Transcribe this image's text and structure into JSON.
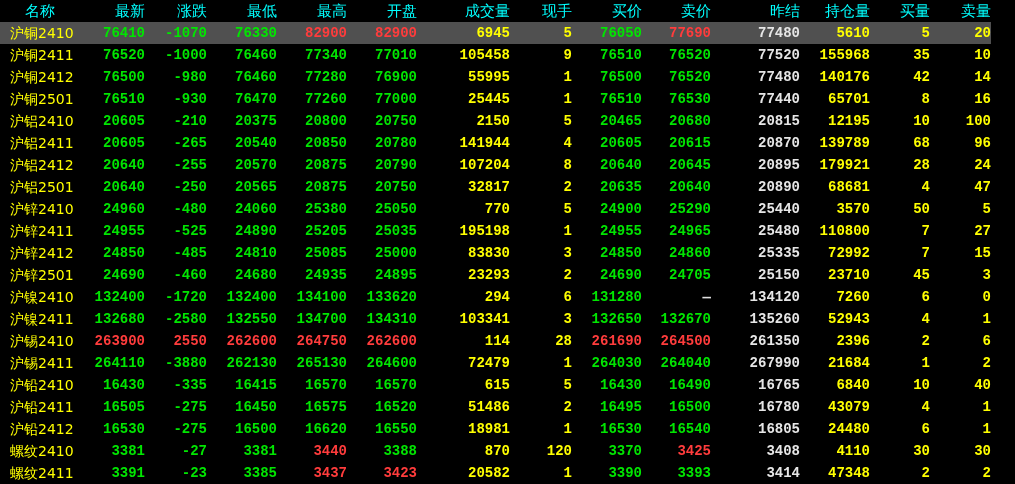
{
  "columns": [
    {
      "label": "名称",
      "kind": "name"
    },
    {
      "label": "最新",
      "kind": "price"
    },
    {
      "label": "涨跌",
      "kind": "price"
    },
    {
      "label": "最低",
      "kind": "price"
    },
    {
      "label": "最高",
      "kind": "price"
    },
    {
      "label": "开盘",
      "kind": "price"
    },
    {
      "label": "成交量",
      "kind": "volume"
    },
    {
      "label": "现手",
      "kind": "volume"
    },
    {
      "label": "买价",
      "kind": "price"
    },
    {
      "label": "卖价",
      "kind": "price"
    },
    {
      "label": "昨结",
      "kind": "settle"
    },
    {
      "label": "持仓量",
      "kind": "volume"
    },
    {
      "label": "买量",
      "kind": "volume"
    },
    {
      "label": "卖量",
      "kind": "volume"
    }
  ],
  "rows": [
    {
      "selected": true,
      "cells": [
        {
          "text": "沪铜2410"
        },
        {
          "text": "76410",
          "color": "#00e600"
        },
        {
          "text": "-1070",
          "color": "#00e600"
        },
        {
          "text": "76330",
          "color": "#00e600"
        },
        {
          "text": "82900",
          "color": "#ff3c3c"
        },
        {
          "text": "82900",
          "color": "#ff3c3c"
        },
        {
          "text": "6945"
        },
        {
          "text": "5"
        },
        {
          "text": "76050",
          "color": "#00e600"
        },
        {
          "text": "77690",
          "color": "#ff3c3c"
        },
        {
          "text": "77480"
        },
        {
          "text": "5610"
        },
        {
          "text": "5"
        },
        {
          "text": "20"
        }
      ]
    },
    {
      "selected": false,
      "cells": [
        {
          "text": "沪铜2411"
        },
        {
          "text": "76520",
          "color": "#00e600"
        },
        {
          "text": "-1000",
          "color": "#00e600"
        },
        {
          "text": "76460",
          "color": "#00e600"
        },
        {
          "text": "77340",
          "color": "#00e600"
        },
        {
          "text": "77010",
          "color": "#00e600"
        },
        {
          "text": "105458"
        },
        {
          "text": "9"
        },
        {
          "text": "76510",
          "color": "#00e600"
        },
        {
          "text": "76520",
          "color": "#00e600"
        },
        {
          "text": "77520"
        },
        {
          "text": "155968"
        },
        {
          "text": "35"
        },
        {
          "text": "10"
        }
      ]
    },
    {
      "selected": false,
      "cells": [
        {
          "text": "沪铜2412"
        },
        {
          "text": "76500",
          "color": "#00e600"
        },
        {
          "text": "-980",
          "color": "#00e600"
        },
        {
          "text": "76460",
          "color": "#00e600"
        },
        {
          "text": "77280",
          "color": "#00e600"
        },
        {
          "text": "76900",
          "color": "#00e600"
        },
        {
          "text": "55995"
        },
        {
          "text": "1"
        },
        {
          "text": "76500",
          "color": "#00e600"
        },
        {
          "text": "76520",
          "color": "#00e600"
        },
        {
          "text": "77480"
        },
        {
          "text": "140176"
        },
        {
          "text": "42"
        },
        {
          "text": "14"
        }
      ]
    },
    {
      "selected": false,
      "cells": [
        {
          "text": "沪铜2501"
        },
        {
          "text": "76510",
          "color": "#00e600"
        },
        {
          "text": "-930",
          "color": "#00e600"
        },
        {
          "text": "76470",
          "color": "#00e600"
        },
        {
          "text": "77260",
          "color": "#00e600"
        },
        {
          "text": "77000",
          "color": "#00e600"
        },
        {
          "text": "25445"
        },
        {
          "text": "1"
        },
        {
          "text": "76510",
          "color": "#00e600"
        },
        {
          "text": "76530",
          "color": "#00e600"
        },
        {
          "text": "77440"
        },
        {
          "text": "65701"
        },
        {
          "text": "8"
        },
        {
          "text": "16"
        }
      ]
    },
    {
      "selected": false,
      "cells": [
        {
          "text": "沪铝2410"
        },
        {
          "text": "20605",
          "color": "#00e600"
        },
        {
          "text": "-210",
          "color": "#00e600"
        },
        {
          "text": "20375",
          "color": "#00e600"
        },
        {
          "text": "20800",
          "color": "#00e600"
        },
        {
          "text": "20750",
          "color": "#00e600"
        },
        {
          "text": "2150"
        },
        {
          "text": "5"
        },
        {
          "text": "20465",
          "color": "#00e600"
        },
        {
          "text": "20680",
          "color": "#00e600"
        },
        {
          "text": "20815"
        },
        {
          "text": "12195"
        },
        {
          "text": "10"
        },
        {
          "text": "100"
        }
      ]
    },
    {
      "selected": false,
      "cells": [
        {
          "text": "沪铝2411"
        },
        {
          "text": "20605",
          "color": "#00e600"
        },
        {
          "text": "-265",
          "color": "#00e600"
        },
        {
          "text": "20540",
          "color": "#00e600"
        },
        {
          "text": "20850",
          "color": "#00e600"
        },
        {
          "text": "20780",
          "color": "#00e600"
        },
        {
          "text": "141944"
        },
        {
          "text": "4"
        },
        {
          "text": "20605",
          "color": "#00e600"
        },
        {
          "text": "20615",
          "color": "#00e600"
        },
        {
          "text": "20870"
        },
        {
          "text": "139789"
        },
        {
          "text": "68"
        },
        {
          "text": "96"
        }
      ]
    },
    {
      "selected": false,
      "cells": [
        {
          "text": "沪铝2412"
        },
        {
          "text": "20640",
          "color": "#00e600"
        },
        {
          "text": "-255",
          "color": "#00e600"
        },
        {
          "text": "20570",
          "color": "#00e600"
        },
        {
          "text": "20875",
          "color": "#00e600"
        },
        {
          "text": "20790",
          "color": "#00e600"
        },
        {
          "text": "107204"
        },
        {
          "text": "8"
        },
        {
          "text": "20640",
          "color": "#00e600"
        },
        {
          "text": "20645",
          "color": "#00e600"
        },
        {
          "text": "20895"
        },
        {
          "text": "179921"
        },
        {
          "text": "28"
        },
        {
          "text": "24"
        }
      ]
    },
    {
      "selected": false,
      "cells": [
        {
          "text": "沪铝2501"
        },
        {
          "text": "20640",
          "color": "#00e600"
        },
        {
          "text": "-250",
          "color": "#00e600"
        },
        {
          "text": "20565",
          "color": "#00e600"
        },
        {
          "text": "20875",
          "color": "#00e600"
        },
        {
          "text": "20750",
          "color": "#00e600"
        },
        {
          "text": "32817"
        },
        {
          "text": "2"
        },
        {
          "text": "20635",
          "color": "#00e600"
        },
        {
          "text": "20640",
          "color": "#00e600"
        },
        {
          "text": "20890"
        },
        {
          "text": "68681"
        },
        {
          "text": "4"
        },
        {
          "text": "47"
        }
      ]
    },
    {
      "selected": false,
      "cells": [
        {
          "text": "沪锌2410"
        },
        {
          "text": "24960",
          "color": "#00e600"
        },
        {
          "text": "-480",
          "color": "#00e600"
        },
        {
          "text": "24060",
          "color": "#00e600"
        },
        {
          "text": "25380",
          "color": "#00e600"
        },
        {
          "text": "25050",
          "color": "#00e600"
        },
        {
          "text": "770"
        },
        {
          "text": "5"
        },
        {
          "text": "24900",
          "color": "#00e600"
        },
        {
          "text": "25290",
          "color": "#00e600"
        },
        {
          "text": "25440"
        },
        {
          "text": "3570"
        },
        {
          "text": "50"
        },
        {
          "text": "5"
        }
      ]
    },
    {
      "selected": false,
      "cells": [
        {
          "text": "沪锌2411"
        },
        {
          "text": "24955",
          "color": "#00e600"
        },
        {
          "text": "-525",
          "color": "#00e600"
        },
        {
          "text": "24890",
          "color": "#00e600"
        },
        {
          "text": "25205",
          "color": "#00e600"
        },
        {
          "text": "25035",
          "color": "#00e600"
        },
        {
          "text": "195198"
        },
        {
          "text": "1"
        },
        {
          "text": "24955",
          "color": "#00e600"
        },
        {
          "text": "24965",
          "color": "#00e600"
        },
        {
          "text": "25480"
        },
        {
          "text": "110800"
        },
        {
          "text": "7"
        },
        {
          "text": "27"
        }
      ]
    },
    {
      "selected": false,
      "cells": [
        {
          "text": "沪锌2412"
        },
        {
          "text": "24850",
          "color": "#00e600"
        },
        {
          "text": "-485",
          "color": "#00e600"
        },
        {
          "text": "24810",
          "color": "#00e600"
        },
        {
          "text": "25085",
          "color": "#00e600"
        },
        {
          "text": "25000",
          "color": "#00e600"
        },
        {
          "text": "83830"
        },
        {
          "text": "3"
        },
        {
          "text": "24850",
          "color": "#00e600"
        },
        {
          "text": "24860",
          "color": "#00e600"
        },
        {
          "text": "25335"
        },
        {
          "text": "72992"
        },
        {
          "text": "7"
        },
        {
          "text": "15"
        }
      ]
    },
    {
      "selected": false,
      "cells": [
        {
          "text": "沪锌2501"
        },
        {
          "text": "24690",
          "color": "#00e600"
        },
        {
          "text": "-460",
          "color": "#00e600"
        },
        {
          "text": "24680",
          "color": "#00e600"
        },
        {
          "text": "24935",
          "color": "#00e600"
        },
        {
          "text": "24895",
          "color": "#00e600"
        },
        {
          "text": "23293"
        },
        {
          "text": "2"
        },
        {
          "text": "24690",
          "color": "#00e600"
        },
        {
          "text": "24705",
          "color": "#00e600"
        },
        {
          "text": "25150"
        },
        {
          "text": "23710"
        },
        {
          "text": "45"
        },
        {
          "text": "3"
        }
      ]
    },
    {
      "selected": false,
      "cells": [
        {
          "text": "沪镍2410"
        },
        {
          "text": "132400",
          "color": "#00e600"
        },
        {
          "text": "-1720",
          "color": "#00e600"
        },
        {
          "text": "132400",
          "color": "#00e600"
        },
        {
          "text": "134100",
          "color": "#00e600"
        },
        {
          "text": "133620",
          "color": "#00e600"
        },
        {
          "text": "294"
        },
        {
          "text": "6"
        },
        {
          "text": "131280",
          "color": "#00e600"
        },
        {
          "text": "—",
          "color": "#e0e0e0"
        },
        {
          "text": "134120"
        },
        {
          "text": "7260"
        },
        {
          "text": "6"
        },
        {
          "text": "0"
        }
      ]
    },
    {
      "selected": false,
      "cells": [
        {
          "text": "沪镍2411"
        },
        {
          "text": "132680",
          "color": "#00e600"
        },
        {
          "text": "-2580",
          "color": "#00e600"
        },
        {
          "text": "132550",
          "color": "#00e600"
        },
        {
          "text": "134700",
          "color": "#00e600"
        },
        {
          "text": "134310",
          "color": "#00e600"
        },
        {
          "text": "103341"
        },
        {
          "text": "3"
        },
        {
          "text": "132650",
          "color": "#00e600"
        },
        {
          "text": "132670",
          "color": "#00e600"
        },
        {
          "text": "135260"
        },
        {
          "text": "52943"
        },
        {
          "text": "4"
        },
        {
          "text": "1"
        }
      ]
    },
    {
      "selected": false,
      "cells": [
        {
          "text": "沪锡2410"
        },
        {
          "text": "263900",
          "color": "#ff3c3c"
        },
        {
          "text": "2550",
          "color": "#ff3c3c"
        },
        {
          "text": "262600",
          "color": "#ff3c3c"
        },
        {
          "text": "264750",
          "color": "#ff3c3c"
        },
        {
          "text": "262600",
          "color": "#ff3c3c"
        },
        {
          "text": "114"
        },
        {
          "text": "28"
        },
        {
          "text": "261690",
          "color": "#ff3c3c"
        },
        {
          "text": "264500",
          "color": "#ff3c3c"
        },
        {
          "text": "261350"
        },
        {
          "text": "2396"
        },
        {
          "text": "2"
        },
        {
          "text": "6"
        }
      ]
    },
    {
      "selected": false,
      "cells": [
        {
          "text": "沪锡2411"
        },
        {
          "text": "264110",
          "color": "#00e600"
        },
        {
          "text": "-3880",
          "color": "#00e600"
        },
        {
          "text": "262130",
          "color": "#00e600"
        },
        {
          "text": "265130",
          "color": "#00e600"
        },
        {
          "text": "264600",
          "color": "#00e600"
        },
        {
          "text": "72479"
        },
        {
          "text": "1"
        },
        {
          "text": "264030",
          "color": "#00e600"
        },
        {
          "text": "264040",
          "color": "#00e600"
        },
        {
          "text": "267990"
        },
        {
          "text": "21684"
        },
        {
          "text": "1"
        },
        {
          "text": "2"
        }
      ]
    },
    {
      "selected": false,
      "cells": [
        {
          "text": "沪铅2410"
        },
        {
          "text": "16430",
          "color": "#00e600"
        },
        {
          "text": "-335",
          "color": "#00e600"
        },
        {
          "text": "16415",
          "color": "#00e600"
        },
        {
          "text": "16570",
          "color": "#00e600"
        },
        {
          "text": "16570",
          "color": "#00e600"
        },
        {
          "text": "615"
        },
        {
          "text": "5"
        },
        {
          "text": "16430",
          "color": "#00e600"
        },
        {
          "text": "16490",
          "color": "#00e600"
        },
        {
          "text": "16765"
        },
        {
          "text": "6840"
        },
        {
          "text": "10"
        },
        {
          "text": "40"
        }
      ]
    },
    {
      "selected": false,
      "cells": [
        {
          "text": "沪铅2411"
        },
        {
          "text": "16505",
          "color": "#00e600"
        },
        {
          "text": "-275",
          "color": "#00e600"
        },
        {
          "text": "16450",
          "color": "#00e600"
        },
        {
          "text": "16575",
          "color": "#00e600"
        },
        {
          "text": "16520",
          "color": "#00e600"
        },
        {
          "text": "51486"
        },
        {
          "text": "2"
        },
        {
          "text": "16495",
          "color": "#00e600"
        },
        {
          "text": "16500",
          "color": "#00e600"
        },
        {
          "text": "16780"
        },
        {
          "text": "43079"
        },
        {
          "text": "4"
        },
        {
          "text": "1"
        }
      ]
    },
    {
      "selected": false,
      "cells": [
        {
          "text": "沪铅2412"
        },
        {
          "text": "16530",
          "color": "#00e600"
        },
        {
          "text": "-275",
          "color": "#00e600"
        },
        {
          "text": "16500",
          "color": "#00e600"
        },
        {
          "text": "16620",
          "color": "#00e600"
        },
        {
          "text": "16550",
          "color": "#00e600"
        },
        {
          "text": "18981"
        },
        {
          "text": "1"
        },
        {
          "text": "16530",
          "color": "#00e600"
        },
        {
          "text": "16540",
          "color": "#00e600"
        },
        {
          "text": "16805"
        },
        {
          "text": "24480"
        },
        {
          "text": "6"
        },
        {
          "text": "1"
        }
      ]
    },
    {
      "selected": false,
      "cells": [
        {
          "text": "螺纹2410"
        },
        {
          "text": "3381",
          "color": "#00e600"
        },
        {
          "text": "-27",
          "color": "#00e600"
        },
        {
          "text": "3381",
          "color": "#00e600"
        },
        {
          "text": "3440",
          "color": "#ff3c3c"
        },
        {
          "text": "3388",
          "color": "#00e600"
        },
        {
          "text": "870"
        },
        {
          "text": "120"
        },
        {
          "text": "3370",
          "color": "#00e600"
        },
        {
          "text": "3425",
          "color": "#ff3c3c"
        },
        {
          "text": "3408"
        },
        {
          "text": "4110"
        },
        {
          "text": "30"
        },
        {
          "text": "30"
        }
      ]
    },
    {
      "selected": false,
      "cells": [
        {
          "text": "螺纹2411"
        },
        {
          "text": "3391",
          "color": "#00e600"
        },
        {
          "text": "-23",
          "color": "#00e600"
        },
        {
          "text": "3385",
          "color": "#00e600"
        },
        {
          "text": "3437",
          "color": "#ff3c3c"
        },
        {
          "text": "3423",
          "color": "#ff3c3c"
        },
        {
          "text": "20582"
        },
        {
          "text": "1"
        },
        {
          "text": "3390",
          "color": "#00e600"
        },
        {
          "text": "3393",
          "color": "#00e600"
        },
        {
          "text": "3414"
        },
        {
          "text": "47348"
        },
        {
          "text": "2"
        },
        {
          "text": "2"
        }
      ]
    }
  ]
}
